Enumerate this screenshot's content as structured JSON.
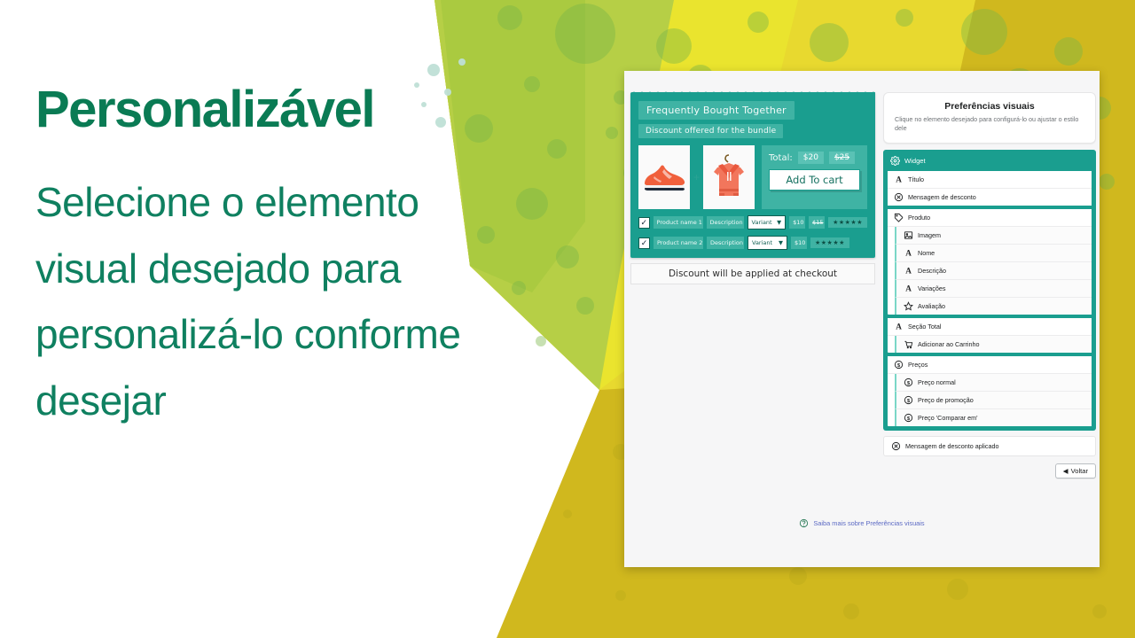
{
  "slide": {
    "headline": "Personalizável",
    "body": "Selecione o elemento visual desejado para personalizá-lo conforme desejar",
    "colors": {
      "headline_green": "#0a7b54",
      "body_green": "#0f8060",
      "teal": "#1a9e8f",
      "gold": "#d0b81e",
      "olive": "#a8c martin"
    }
  },
  "app": {
    "preview": {
      "widget_title": "Frequently Bought Together",
      "widget_subtitle": "Discount offered for the bundle",
      "images": [
        {
          "name": "sneaker-image",
          "alt": "Orange running shoe"
        },
        {
          "name": "hoodie-image",
          "alt": "Coral hoodie on hanger"
        }
      ],
      "plus": "+",
      "total_label": "Total:",
      "total_price": "$20",
      "total_compare_price": "$25",
      "add_to_cart_label": "Add To cart",
      "items": [
        {
          "checked": "✓",
          "name": "Product name 1",
          "description": "Description",
          "variant": "Variant",
          "variant_caret": "▼",
          "price": "$10",
          "compare_price": "$15",
          "rating": "★★★★★"
        },
        {
          "checked": "✓",
          "name": "Product name 2",
          "description": "Description",
          "variant": "Variant",
          "variant_caret": "▼",
          "price": "$10",
          "compare_price": "",
          "rating": "★★★★★"
        }
      ],
      "checkout_note": "Discount will be applied at checkout"
    },
    "settings": {
      "title": "Preferências visuais",
      "description": "Clique no elemento desejado para configurá-lo ou ajustar o estilo dele",
      "tree_root": {
        "icon": "gear-icon",
        "label": "Widget"
      },
      "groups": [
        {
          "rows": [
            {
              "icon": "text-icon",
              "label": "Título",
              "child": false
            },
            {
              "icon": "discount-icon",
              "label": "Mensagem de desconto",
              "child": false
            }
          ]
        },
        {
          "rows": [
            {
              "icon": "tag-icon",
              "label": "Produto",
              "child": false
            },
            {
              "icon": "image-icon",
              "label": "Imagem",
              "child": true
            },
            {
              "icon": "text-icon",
              "label": "Nome",
              "child": true
            },
            {
              "icon": "text-icon",
              "label": "Descrição",
              "child": true
            },
            {
              "icon": "text-icon",
              "label": "Variações",
              "child": true
            },
            {
              "icon": "star-icon",
              "label": "Avaliação",
              "child": true
            }
          ]
        },
        {
          "rows": [
            {
              "icon": "text-icon",
              "label": "Seção Total",
              "child": false
            },
            {
              "icon": "cart-icon",
              "label": "Adicionar ao Carrinho",
              "child": true
            }
          ]
        },
        {
          "rows": [
            {
              "icon": "money-icon",
              "label": "Preços",
              "child": false
            },
            {
              "icon": "money-icon",
              "label": "Preço normal",
              "child": true
            },
            {
              "icon": "money-icon",
              "label": "Preço de promoção",
              "child": true
            },
            {
              "icon": "money-icon",
              "label": "Preço 'Comparar em'",
              "child": true
            }
          ]
        }
      ],
      "applied_message": {
        "icon": "discount-icon",
        "label": "Mensagem de desconto aplicado"
      },
      "back_button": {
        "caret": "◀",
        "label": "Voltar"
      },
      "learn_more": {
        "icon": "question-icon",
        "label": "Saiba mais sobre Preferências visuais"
      }
    }
  }
}
